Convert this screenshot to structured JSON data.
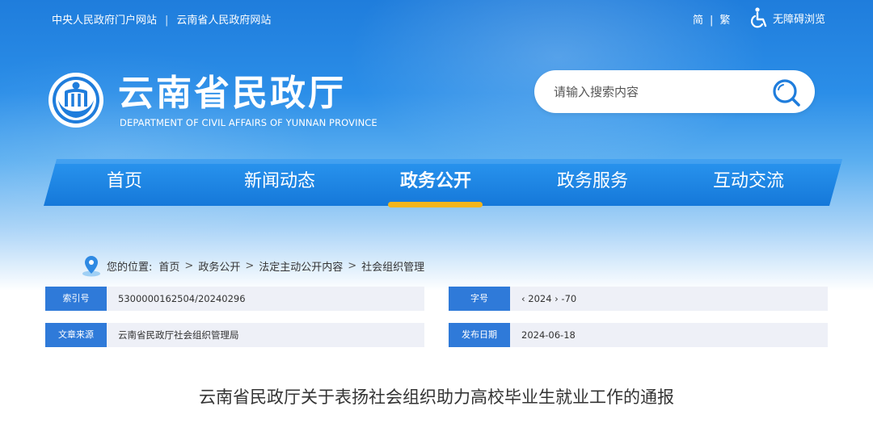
{
  "top_links": [
    "中央人民政府门户网站",
    "云南省人民政府网站"
  ],
  "top_separator": "|",
  "language": {
    "simplified": "简",
    "separator": "|",
    "traditional": "繁"
  },
  "accessibility": {
    "label": "无障碍浏览",
    "icon": "wheelchair-icon"
  },
  "logo": {
    "title": "云南省民政厅",
    "subtitle": "DEPARTMENT OF CIVIL AFFAIRS OF YUNNAN PROVINCE"
  },
  "search": {
    "placeholder": "请输入搜索内容",
    "icon": "search-icon"
  },
  "nav": {
    "items": [
      "首页",
      "新闻动态",
      "政务公开",
      "政务服务",
      "互动交流"
    ],
    "active": "政务公开"
  },
  "breadcrumb": {
    "prefix": "您的位置:",
    "items": [
      "首页",
      "政务公开",
      "法定主动公开内容",
      "社会组织管理"
    ],
    "separator": ">"
  },
  "meta": {
    "index_no": {
      "label": "索引号",
      "value": "5300000162504/20240296"
    },
    "doc_no": {
      "label": "字号",
      "value": "‹ 2024 › -70"
    },
    "source": {
      "label": "文章来源",
      "value": "云南省民政厅社会组织管理局"
    },
    "date": {
      "label": "发布日期",
      "value": "2024-06-18"
    }
  },
  "article": {
    "title": "云南省民政厅关于表扬社会组织助力高校毕业生就业工作的通报"
  },
  "colors": {
    "primary": "#2f7ad9",
    "nav": "#1f86e6",
    "accent": "#f3b51b",
    "meta_bg": "#eef0f7"
  }
}
